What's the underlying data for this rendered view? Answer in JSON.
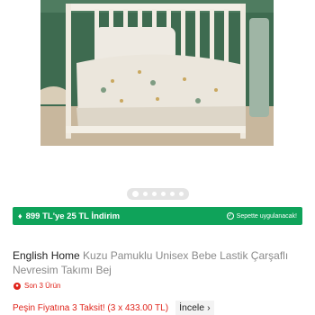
{
  "gallery": {
    "image_alt": "baby-crib-bedding-photo",
    "slide_count": 6,
    "active_slide": 1
  },
  "promo": {
    "icon": "tag-icon",
    "text": "899 TL'ye 25 TL İndirim",
    "badge_text": "Sepette uygulanacak!",
    "color": "#0fa35a"
  },
  "product": {
    "brand": "English Home",
    "name": "Kuzu Pamuklu Unisex Bebe Lastik Çarşaflı Nevresim Takımı Bej"
  },
  "stock": {
    "text": "Son 3 Ürün",
    "color": "#e0241b"
  },
  "installment": {
    "text": "Peşin Fiyatına 3 Taksit! (3 x 433.00 TL)",
    "link_label": "İncele",
    "link_icon": "chevron-right-icon"
  }
}
